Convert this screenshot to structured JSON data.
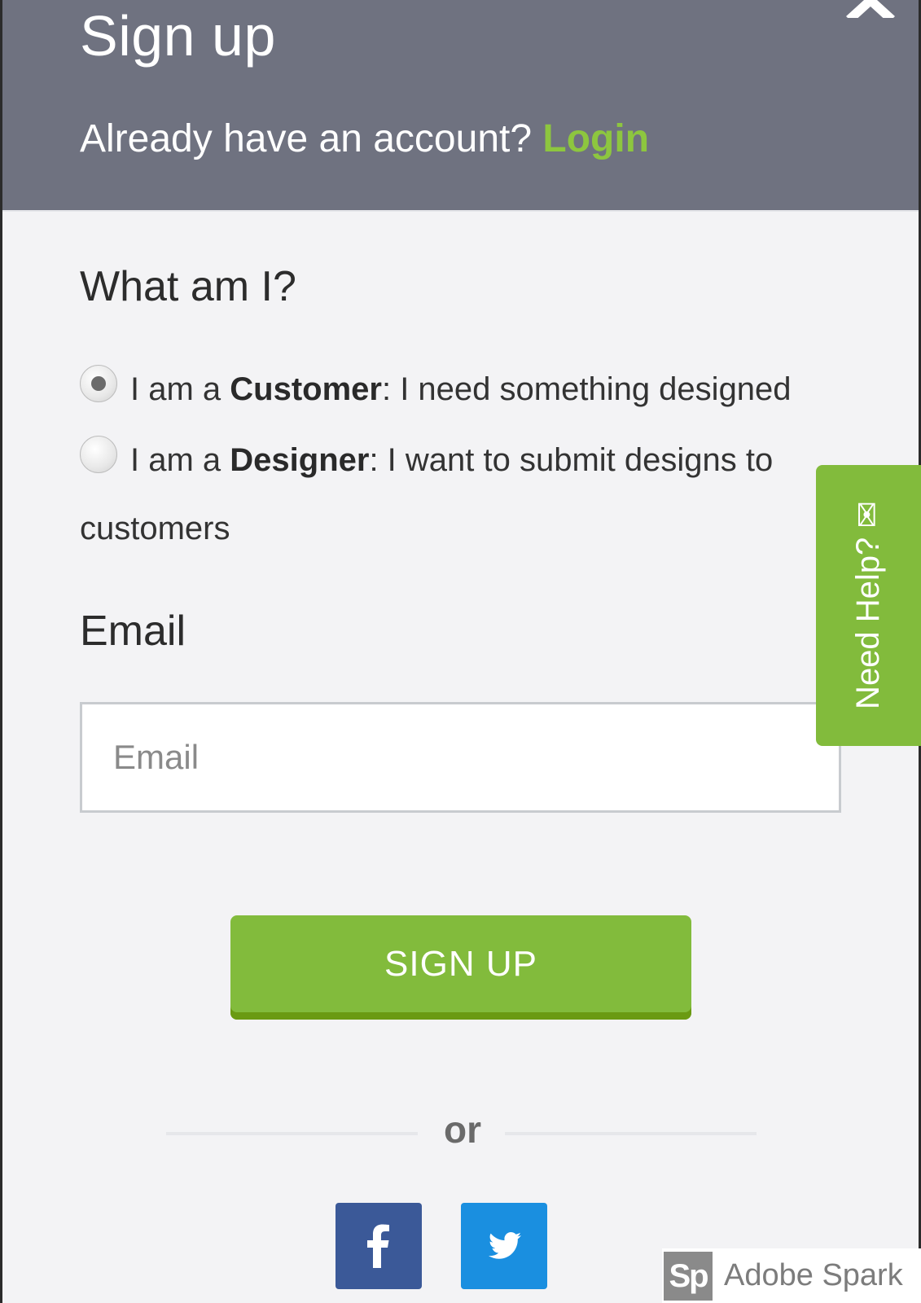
{
  "header": {
    "title": "Sign up",
    "subtitle_prefix": "Already have an account?",
    "login_label": "Login",
    "close_icon": "close-icon"
  },
  "role": {
    "heading": "What am I?",
    "options": [
      {
        "prefix": "I am a ",
        "role": "Customer",
        "suffix": ": I need something designed",
        "selected": true
      },
      {
        "prefix": "I am a ",
        "role": "Designer",
        "suffix": ": I want to submit designs to",
        "continuation": "customers",
        "selected": false
      }
    ]
  },
  "email": {
    "label": "Email",
    "placeholder": "Email",
    "value": ""
  },
  "signup_button": "SIGN UP",
  "divider": "or",
  "social": {
    "facebook_icon": "facebook-icon",
    "twitter_icon": "twitter-icon"
  },
  "help_tab": {
    "label": "Need Help? ✉",
    "icon": "envelope-icon"
  },
  "watermark": {
    "logo": "Sp",
    "text": "Adobe Spark"
  },
  "colors": {
    "header": "#6f7280",
    "accent_green": "#82bb3c",
    "login_green": "#8dc63f",
    "facebook": "#3b5998",
    "twitter": "#1a8fe0",
    "panel": "#f3f3f5"
  }
}
